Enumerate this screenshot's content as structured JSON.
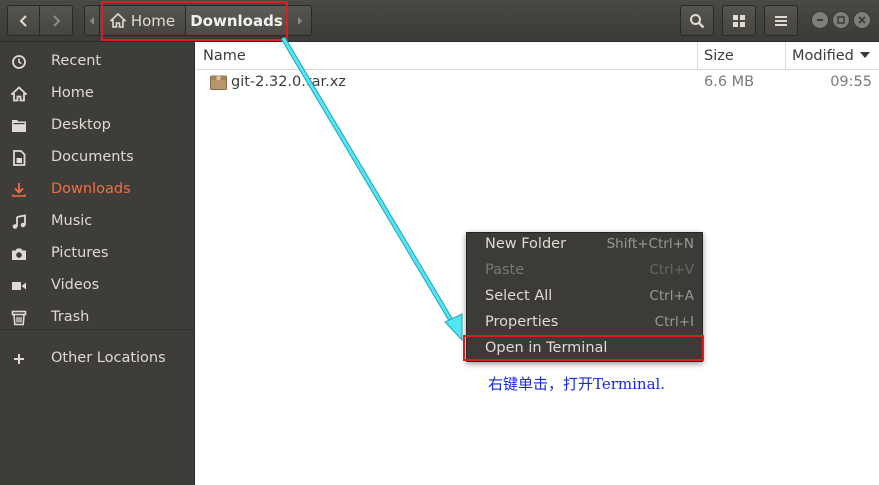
{
  "header": {
    "breadcrumbs": [
      {
        "label": "Home"
      },
      {
        "label": "Downloads"
      }
    ]
  },
  "sidebar": {
    "items": [
      {
        "label": "Recent",
        "icon": "clock-icon"
      },
      {
        "label": "Home",
        "icon": "home-icon"
      },
      {
        "label": "Desktop",
        "icon": "folder-icon"
      },
      {
        "label": "Documents",
        "icon": "document-icon"
      },
      {
        "label": "Downloads",
        "icon": "download-icon"
      },
      {
        "label": "Music",
        "icon": "music-icon"
      },
      {
        "label": "Pictures",
        "icon": "camera-icon"
      },
      {
        "label": "Videos",
        "icon": "video-icon"
      },
      {
        "label": "Trash",
        "icon": "trash-icon"
      }
    ],
    "other_locations": "Other Locations",
    "active_color": "#f2703f"
  },
  "list": {
    "columns": {
      "name": "Name",
      "size": "Size",
      "modified": "Modified"
    },
    "files": [
      {
        "name": "git-2.32.0.tar.xz",
        "size": "6.6 MB",
        "modified": "09:55",
        "icon": "archive-icon"
      }
    ]
  },
  "context_menu": {
    "items": [
      {
        "label": "New Folder",
        "shortcut": "Shift+Ctrl+N",
        "enabled": true
      },
      {
        "label": "Paste",
        "shortcut": "Ctrl+V",
        "enabled": false
      },
      {
        "label": "Select All",
        "shortcut": "Ctrl+A",
        "enabled": true
      },
      {
        "label": "Properties",
        "shortcut": "Ctrl+I",
        "enabled": true
      },
      {
        "label": "Open in Terminal",
        "shortcut": "",
        "enabled": true
      }
    ]
  },
  "annotation": {
    "text": "右键单击，打开Terminal.",
    "text_color": "#1a2ad6",
    "highlight_color": "#e01b24",
    "arrow_color": "#37d6e8"
  }
}
